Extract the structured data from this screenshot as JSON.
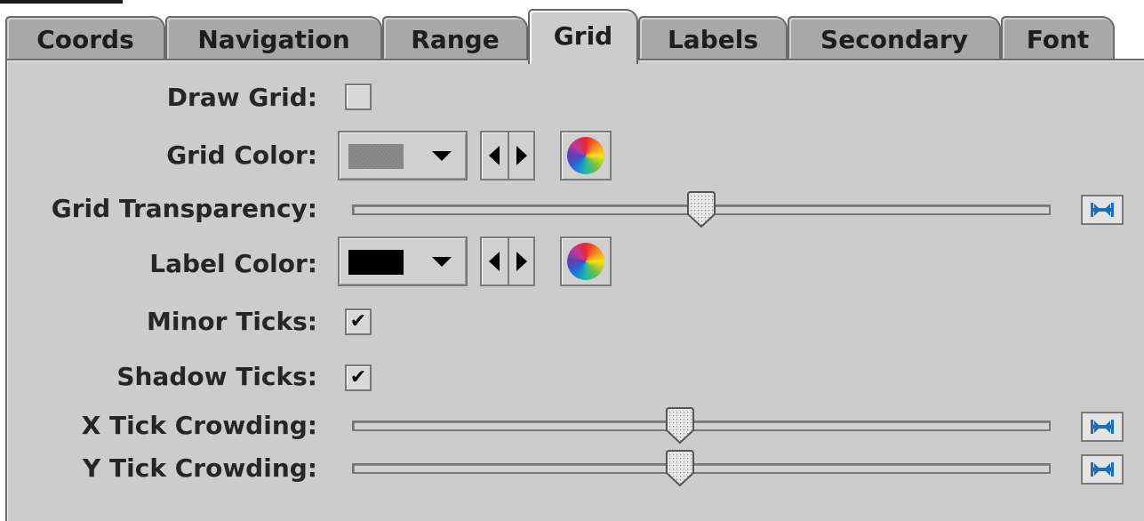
{
  "tabs": [
    {
      "label": "Coords",
      "selected": false
    },
    {
      "label": "Navigation",
      "selected": false
    },
    {
      "label": "Range",
      "selected": false
    },
    {
      "label": "Grid",
      "selected": true
    },
    {
      "label": "Labels",
      "selected": false
    },
    {
      "label": "Secondary",
      "selected": false
    },
    {
      "label": "Font",
      "selected": false
    }
  ],
  "grid": {
    "draw_grid": {
      "label": "Draw Grid:",
      "checked": false
    },
    "grid_color": {
      "label": "Grid Color:",
      "color": "#8c8c8c"
    },
    "grid_transparency": {
      "label": "Grid Transparency:",
      "value": 0.5
    },
    "label_color": {
      "label": "Label Color:",
      "color": "#000000"
    },
    "minor_ticks": {
      "label": "Minor Ticks:",
      "checked": true
    },
    "shadow_ticks": {
      "label": "Shadow Ticks:",
      "checked": true
    },
    "x_tick_crowding": {
      "label": "X Tick Crowding:",
      "value": 0.47
    },
    "y_tick_crowding": {
      "label": "Y Tick Crowding:",
      "value": 0.47
    }
  },
  "icons": {
    "check_glyph": "✔",
    "color_wheel": "color-wheel-icon",
    "reset": "reset-slider-icon"
  },
  "colors": {
    "panel": "#cccccc",
    "tab_inactive": "#a8a8a8",
    "reset_icon": "#1d6fb8"
  }
}
